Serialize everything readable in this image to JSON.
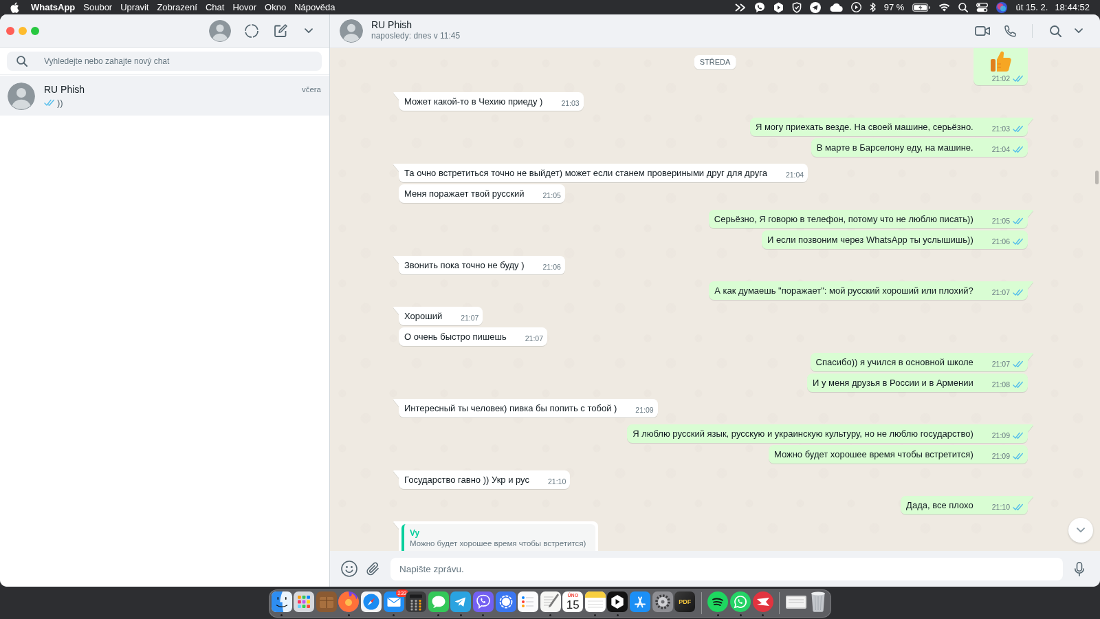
{
  "menubar": {
    "app_name": "WhatsApp",
    "menus": [
      "Soubor",
      "Upravit",
      "Zobrazení",
      "Chat",
      "Hovor",
      "Okno",
      "Nápověda"
    ],
    "status_items": [
      {
        "kind": "arrows"
      },
      {
        "kind": "viber"
      },
      {
        "kind": "hexagon"
      },
      {
        "kind": "shield"
      },
      {
        "kind": "plane"
      },
      {
        "kind": "cloud"
      },
      {
        "kind": "play"
      },
      {
        "kind": "bluetooth"
      },
      {
        "kind": "percentage",
        "text": "97 %"
      },
      {
        "kind": "battery"
      },
      {
        "kind": "wifi"
      },
      {
        "kind": "search"
      },
      {
        "kind": "controls"
      },
      {
        "kind": "siri"
      }
    ],
    "date": "út 15. 2.",
    "time": "18:44:52"
  },
  "sidebar": {
    "search": {
      "placeholder": "Vyhledejte nebo zahajte nový chat"
    },
    "chats": [
      {
        "name": "RU Phish",
        "time": "včera",
        "preview": "))",
        "read": true,
        "selected": true
      }
    ]
  },
  "chat": {
    "contact": {
      "name": "RU Phish",
      "status": "naposledy: dnes v 11:45"
    },
    "date_chip": "STŘEDA",
    "messages": [
      {
        "kind": "sticker",
        "outgoing": true,
        "time": "21:02",
        "read": true
      },
      {
        "kind": "text",
        "outgoing": false,
        "text": "Может какой-то в Чехию приеду )",
        "time": "21:03"
      },
      {
        "kind": "text",
        "outgoing": true,
        "text": "Я могу приехать везде. На своей машине, серьёзно.",
        "time": "21:03",
        "read": true
      },
      {
        "kind": "text",
        "outgoing": true,
        "text": "В марте в Барселону еду, на машине.",
        "time": "21:04",
        "read": true
      },
      {
        "kind": "text",
        "outgoing": false,
        "text": "Та очно встретиться точно не выйдет) может если станем провериными друг для друга",
        "time": "21:04"
      },
      {
        "kind": "text",
        "outgoing": false,
        "text": "Меня поражает твой русский",
        "time": "21:05"
      },
      {
        "kind": "text",
        "outgoing": true,
        "text": "Серьёзно, Я говорю в телефон, потому что не люблю писать))",
        "time": "21:05",
        "read": true
      },
      {
        "kind": "text",
        "outgoing": true,
        "text": "И если позвоним через WhatsApp ты услышишь))",
        "time": "21:06",
        "read": true
      },
      {
        "kind": "text",
        "outgoing": false,
        "text": "Звонить пока точно не буду )",
        "time": "21:06"
      },
      {
        "kind": "text",
        "outgoing": true,
        "text": "А как думаешь \"поражает\": мой русский хороший или плохий?",
        "time": "21:07",
        "read": true
      },
      {
        "kind": "text",
        "outgoing": false,
        "text": "Хороший",
        "time": "21:07"
      },
      {
        "kind": "text",
        "outgoing": false,
        "text": "О очень быстро пишешь",
        "time": "21:07"
      },
      {
        "kind": "text",
        "outgoing": true,
        "text": "Спасибо)) я учился в основной школе",
        "time": "21:07",
        "read": true
      },
      {
        "kind": "text",
        "outgoing": true,
        "text": "И у меня друзья в России и в Армении",
        "time": "21:08",
        "read": true
      },
      {
        "kind": "text",
        "outgoing": false,
        "text": "Интересный ты человек) пивка бы попить с тобой )",
        "time": "21:09"
      },
      {
        "kind": "text",
        "outgoing": true,
        "text": "Я люблю русский язык, русскую и украинскую культуру, но не люблю государство)",
        "time": "21:09",
        "read": true
      },
      {
        "kind": "text",
        "outgoing": true,
        "text": "Можно будет хорошее время чтобы встретится)",
        "time": "21:09",
        "read": true
      },
      {
        "kind": "text",
        "outgoing": false,
        "text": "Государство гавно )) Укр и рус",
        "time": "21:10"
      },
      {
        "kind": "text",
        "outgoing": true,
        "text": "Дада, все плохо",
        "time": "21:10",
        "read": true
      },
      {
        "kind": "reply",
        "outgoing": false,
        "quote_author": "Vy",
        "quote_text": "Можно будет хорошее время чтобы встретится)"
      }
    ],
    "composer": {
      "placeholder": "Napište zprávu."
    }
  },
  "dock": {
    "items": [
      {
        "kind": "finder",
        "running": true
      },
      {
        "kind": "launchpad",
        "running": false
      },
      {
        "kind": "box",
        "running": false
      },
      {
        "kind": "firefox",
        "running": true
      },
      {
        "kind": "safari",
        "running": false
      },
      {
        "kind": "mail",
        "badge": "233",
        "running": true
      },
      {
        "kind": "calculator",
        "running": false
      },
      {
        "kind": "messages",
        "running": true
      },
      {
        "kind": "telegram",
        "running": true
      },
      {
        "kind": "viber",
        "running": true
      },
      {
        "kind": "signal",
        "running": false
      },
      {
        "kind": "reminders",
        "running": false
      },
      {
        "kind": "textedit",
        "running": true
      },
      {
        "kind": "calendar",
        "month": "ÚNO",
        "day": "15",
        "running": false
      },
      {
        "kind": "notes",
        "running": true
      },
      {
        "kind": "hexagon",
        "running": true
      },
      {
        "kind": "appstore",
        "running": false
      },
      {
        "kind": "settings",
        "running": false
      },
      {
        "kind": "pdf",
        "label": "PDF",
        "running": false
      },
      {
        "kind": "separator"
      },
      {
        "kind": "spotify",
        "running": true
      },
      {
        "kind": "whatsapp",
        "running": true
      },
      {
        "kind": "airmail",
        "running": true
      },
      {
        "kind": "separator"
      },
      {
        "kind": "stack",
        "running": false
      },
      {
        "kind": "trash",
        "running": false
      }
    ]
  }
}
